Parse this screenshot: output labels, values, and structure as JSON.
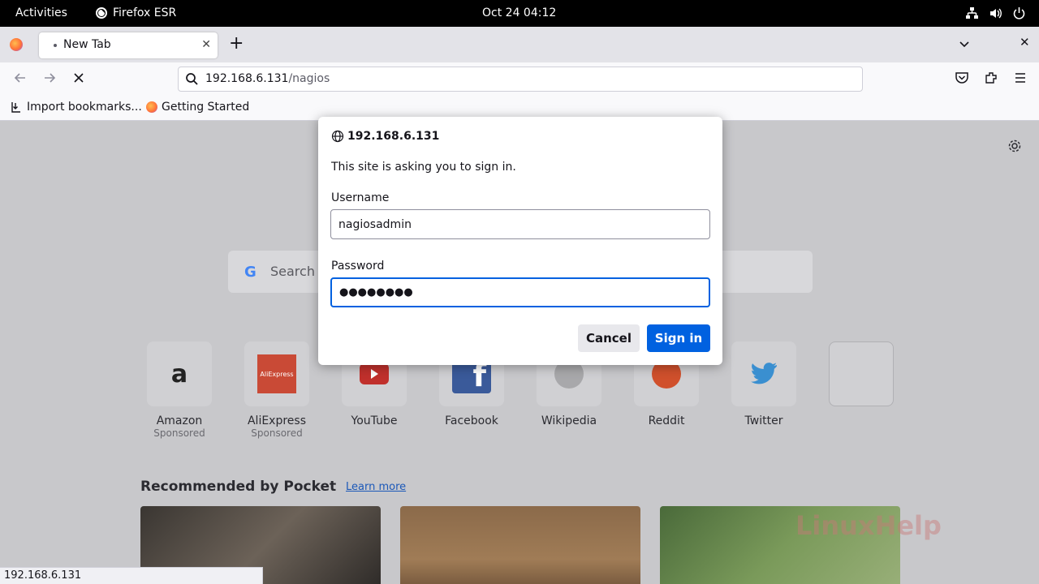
{
  "topbar": {
    "activities": "Activities",
    "app_name": "Firefox ESR",
    "clock": "Oct 24  04:12"
  },
  "tabs": [
    {
      "title": "New Tab"
    }
  ],
  "urlbar": {
    "host": "192.168.6.131",
    "path": "/nagios"
  },
  "bookmarks": [
    {
      "label": "Import bookmarks..."
    },
    {
      "label": "Getting Started"
    }
  ],
  "newtab": {
    "search_placeholder": "Search the Web",
    "shortcuts": [
      {
        "label": "Amazon",
        "sub": "Sponsored",
        "icon": "amazon-icon"
      },
      {
        "label": "AliExpress",
        "sub": "Sponsored",
        "icon": "aliexpress-icon"
      },
      {
        "label": "YouTube",
        "sub": "",
        "icon": "youtube-icon"
      },
      {
        "label": "Facebook",
        "sub": "",
        "icon": "facebook-icon"
      },
      {
        "label": "Wikipedia",
        "sub": "",
        "icon": "wikipedia-icon"
      },
      {
        "label": "Reddit",
        "sub": "",
        "icon": "reddit-icon"
      },
      {
        "label": "Twitter",
        "sub": "",
        "icon": "twitter-icon"
      },
      {
        "label": "",
        "sub": "",
        "icon": "empty-tile"
      }
    ],
    "pocket_title": "Recommended by Pocket",
    "pocket_learn_more": "Learn more",
    "watermark": "LinuxHelp"
  },
  "status_url": "192.168.6.131",
  "auth_dialog": {
    "host": "192.168.6.131",
    "message": "This site is asking you to sign in.",
    "username_label": "Username",
    "username_value": "nagiosadmin",
    "password_label": "Password",
    "password_value": "●●●●●●●●",
    "cancel_label": "Cancel",
    "signin_label": "Sign in"
  },
  "colors": {
    "accent": "#0061e0",
    "topbar": "#000000"
  }
}
